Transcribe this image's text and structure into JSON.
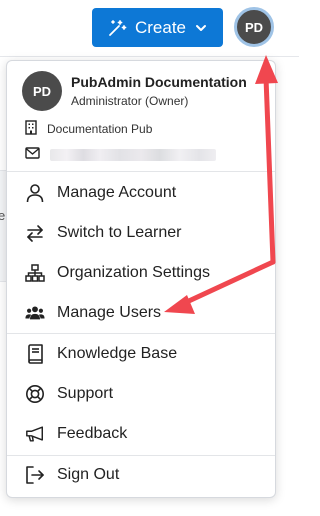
{
  "header": {
    "create_label": "Create",
    "avatar_initials": "PD"
  },
  "background": {
    "partial_text": "e"
  },
  "profile": {
    "initials": "PD",
    "name": "PubAdmin Documentation",
    "role": "Administrator (Owner)",
    "organization": "Documentation Pub"
  },
  "menu": {
    "items": [
      {
        "label": "Manage Account",
        "icon": "user-icon"
      },
      {
        "label": "Switch to Learner",
        "icon": "switch-arrows-icon"
      },
      {
        "label": "Organization Settings",
        "icon": "org-chart-icon"
      },
      {
        "label": "Manage Users",
        "icon": "users-icon"
      },
      {
        "label": "Knowledge Base",
        "icon": "book-icon"
      },
      {
        "label": "Support",
        "icon": "lifebuoy-icon"
      },
      {
        "label": "Feedback",
        "icon": "megaphone-icon"
      },
      {
        "label": "Sign Out",
        "icon": "sign-out-icon"
      }
    ]
  },
  "colors": {
    "primary": "#0d78d6",
    "avatar_bg": "#4b4b4b",
    "annotation_arrow": "#f0474f"
  }
}
